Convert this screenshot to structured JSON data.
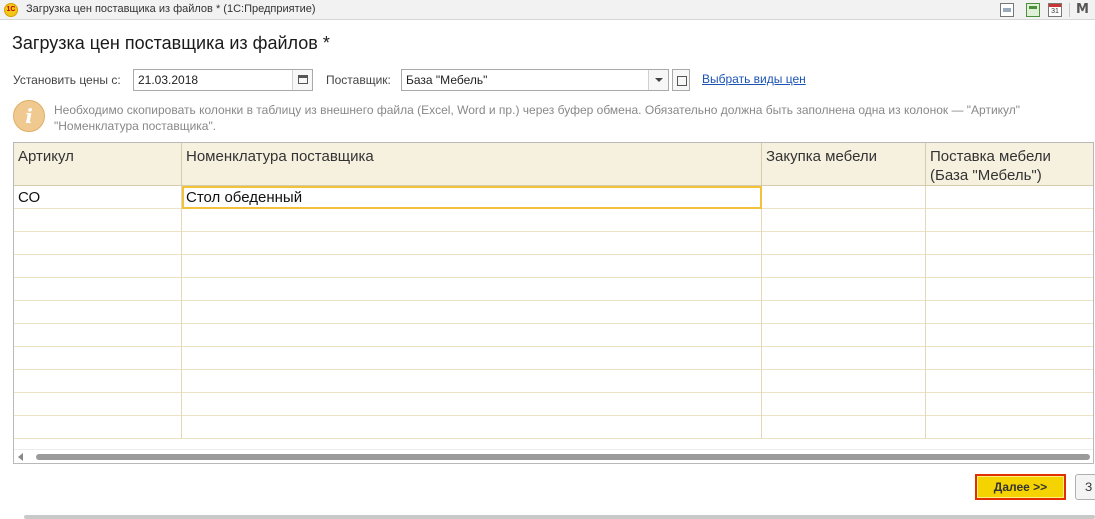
{
  "window": {
    "title": "Загрузка цен поставщика из файлов *  (1С:Предприятие)",
    "logo_text": "1С",
    "calendar_day": "31",
    "menu_glyph": "M"
  },
  "form": {
    "title": "Загрузка цен поставщика из файлов *"
  },
  "params": {
    "date_label": "Установить цены с:",
    "date_value": "21.03.2018",
    "supplier_label": "Поставщик:",
    "supplier_value": "База \"Мебель\"",
    "link_label": "Выбрать виды цен"
  },
  "hint": {
    "icon": "info-icon",
    "line1": "Необходимо скопировать колонки в таблицу из внешнего файла (Excel, Word и пр.) через буфер обмена. Обязательно должна быть заполнена одна из колонок — \"Артикул\"",
    "line2": "\"Номенклатура поставщика\"."
  },
  "table": {
    "columns": [
      {
        "line1": "Артикул",
        "line2": ""
      },
      {
        "line1": "Номенклатура поставщика",
        "line2": ""
      },
      {
        "line1": "Закупка мебели",
        "line2": ""
      },
      {
        "line1": "Поставка мебели",
        "line2": "(База \"Мебель\")"
      }
    ],
    "rows": [
      {
        "article": "СО",
        "nomenclature": "Стол обеденный",
        "purchase": "",
        "delivery": ""
      }
    ]
  },
  "buttons": {
    "next_label": "Далее >>",
    "close_label": "З"
  },
  "colors": {
    "accent_button": "#f5d300",
    "accent_border": "#e03000",
    "grid_header": "#f6f1df",
    "link": "#1b53b3"
  }
}
